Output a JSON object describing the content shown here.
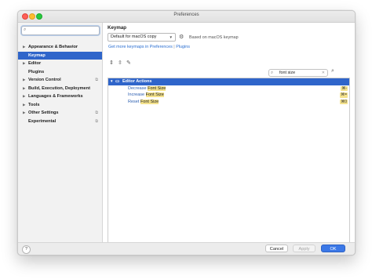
{
  "window": {
    "title": "Preferences"
  },
  "sidebar": {
    "search_placeholder": "",
    "items": [
      {
        "label": "Appearance & Behavior",
        "expandable": true,
        "selected": false,
        "project_icon": false
      },
      {
        "label": "Keymap",
        "expandable": false,
        "selected": true,
        "project_icon": false
      },
      {
        "label": "Editor",
        "expandable": true,
        "selected": false,
        "project_icon": false
      },
      {
        "label": "Plugins",
        "expandable": false,
        "selected": false,
        "project_icon": false
      },
      {
        "label": "Version Control",
        "expandable": true,
        "selected": false,
        "project_icon": true
      },
      {
        "label": "Build, Execution, Deployment",
        "expandable": true,
        "selected": false,
        "project_icon": false
      },
      {
        "label": "Languages & Frameworks",
        "expandable": true,
        "selected": false,
        "project_icon": false
      },
      {
        "label": "Tools",
        "expandable": true,
        "selected": false,
        "project_icon": false
      },
      {
        "label": "Other Settings",
        "expandable": true,
        "selected": false,
        "project_icon": true
      },
      {
        "label": "Experimental",
        "expandable": false,
        "selected": false,
        "project_icon": true
      }
    ]
  },
  "content": {
    "title": "Keymap",
    "scheme_value": "Default for macOS copy",
    "based_on": "Based on macOS keymap",
    "link_prefix": "Get more keymaps in Preferences",
    "link_sep": "|",
    "link_plugins": "Plugins",
    "search_value": "font size",
    "tree": {
      "group": "Editor Actions",
      "actions": [
        {
          "prefix": "Decrease ",
          "match": "Font Size",
          "shortcut": "⌘-"
        },
        {
          "prefix": "Increase ",
          "match": "Font Size",
          "shortcut": "⌘="
        },
        {
          "prefix": "Reset ",
          "match": "Font Size",
          "shortcut": "⌘0"
        }
      ]
    }
  },
  "footer": {
    "help": "?",
    "cancel": "Cancel",
    "apply": "Apply",
    "ok": "OK"
  },
  "colors": {
    "selection": "#2f65ca",
    "highlight": "#f4e28c",
    "link": "#2a6ed1",
    "ok_button": "#3b78e7"
  }
}
